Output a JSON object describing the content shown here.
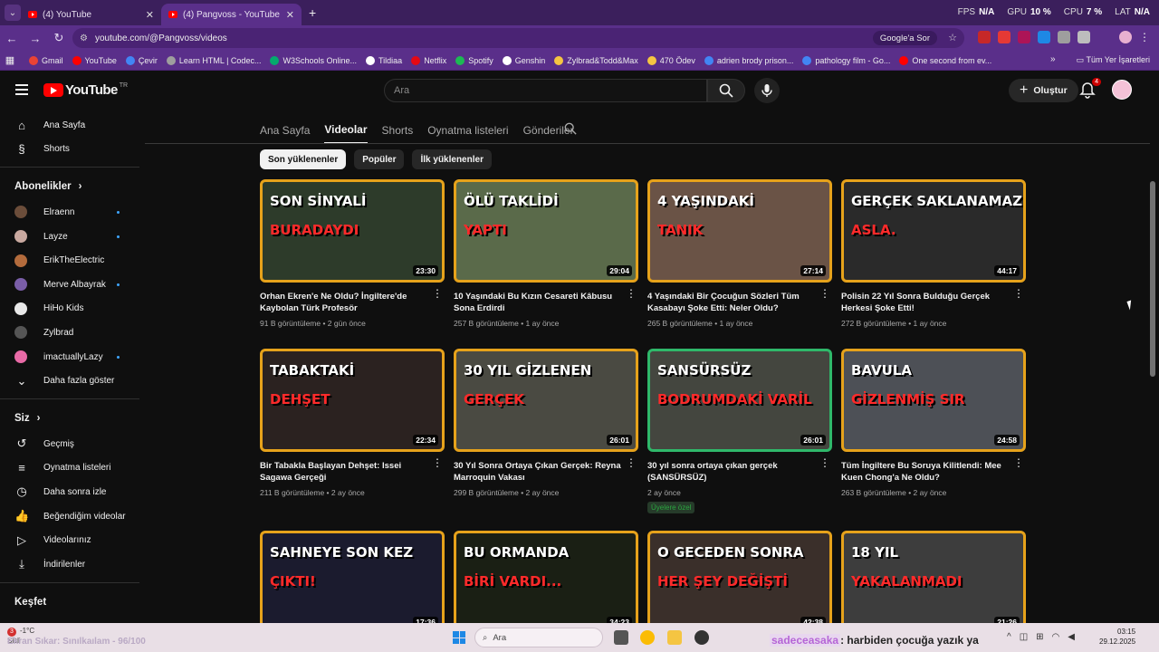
{
  "browser": {
    "tabs": [
      {
        "title": "(4) YouTube",
        "active": false
      },
      {
        "title": "(4) Pangvoss - YouTube",
        "active": true
      }
    ],
    "stats": [
      {
        "label": "FPS",
        "value": "N/A"
      },
      {
        "label": "GPU",
        "value": "10 %"
      },
      {
        "label": "CPU",
        "value": "7 %"
      },
      {
        "label": "LAT",
        "value": "N/A"
      }
    ],
    "url": "youtube.com/@Pangvoss/videos",
    "google_sor": "Google'a Sor",
    "bookmarks": [
      {
        "label": "Gmail",
        "color": "#ea4335"
      },
      {
        "label": "YouTube",
        "color": "#ff0000"
      },
      {
        "label": "Çevir",
        "color": "#4285f4"
      },
      {
        "label": "Learn HTML | Codec...",
        "color": "#9e9e9e"
      },
      {
        "label": "W3Schools Online...",
        "color": "#04aa6d"
      },
      {
        "label": "Tildiaa",
        "color": "#ffffff"
      },
      {
        "label": "Netflix",
        "color": "#e50914"
      },
      {
        "label": "Spotify",
        "color": "#1db954"
      },
      {
        "label": "Genshin",
        "color": "#ffffff"
      },
      {
        "label": "Zylbrad&Todd&Max",
        "color": "#f5c542"
      },
      {
        "label": "470 Ödev",
        "color": "#f5c542"
      },
      {
        "label": "adrien brody prison...",
        "color": "#4285f4"
      },
      {
        "label": "pathology film - Go...",
        "color": "#4285f4"
      },
      {
        "label": "One second from ev...",
        "color": "#ff0000"
      }
    ],
    "bookmarks_more": "»",
    "all_bookmarks": "Tüm Yer İşaretleri"
  },
  "header": {
    "logo": "YouTube",
    "logo_sup": "TR",
    "search_placeholder": "Ara",
    "create_label": "Oluştur",
    "notif_count": "4"
  },
  "sidebar": {
    "primary": [
      {
        "label": "Ana Sayfa",
        "icon": "home-icon",
        "glyph": "⌂"
      },
      {
        "label": "Shorts",
        "icon": "shorts-icon",
        "glyph": "§"
      }
    ],
    "subs_title": "Abonelikler",
    "subscriptions": [
      {
        "label": "Elraenn",
        "color": "#6b4d3a",
        "dot": true
      },
      {
        "label": "Layze",
        "color": "#c9a9a0",
        "dot": true
      },
      {
        "label": "ErikTheElectric",
        "color": "#b36b3c",
        "dot": false
      },
      {
        "label": "Merve Albayrak",
        "color": "#7a5ea8",
        "dot": true
      },
      {
        "label": "HiHo Kids",
        "color": "#e8e8e8",
        "dot": false
      },
      {
        "label": "Zylbrad",
        "color": "#555555",
        "dot": false
      },
      {
        "label": "imactuallyLazy",
        "color": "#e86aa6",
        "dot": true
      }
    ],
    "show_more": "Daha fazla göster",
    "you_title": "Siz",
    "you_items": [
      {
        "label": "Geçmiş",
        "icon": "history-icon",
        "glyph": "↺"
      },
      {
        "label": "Oynatma listeleri",
        "icon": "playlists-icon",
        "glyph": "≡"
      },
      {
        "label": "Daha sonra izle",
        "icon": "watch-later-icon",
        "glyph": "◷"
      },
      {
        "label": "Beğendiğim videolar",
        "icon": "like-icon",
        "glyph": "👍"
      },
      {
        "label": "Videolarınız",
        "icon": "your-videos-icon",
        "glyph": "▷"
      },
      {
        "label": "İndirilenler",
        "icon": "downloads-icon",
        "glyph": "⤓"
      }
    ],
    "explore_title": "Keşfet"
  },
  "channel": {
    "tabs": [
      "Ana Sayfa",
      "Videolar",
      "Shorts",
      "Oynatma listeleri",
      "Gönderiler"
    ],
    "active_tab": "Videolar",
    "chips": [
      "Son yüklenenler",
      "Popüler",
      "İlk yüklenenler"
    ],
    "active_chip": "Son yüklenenler"
  },
  "videos": [
    {
      "title": "Orhan Ekren'e Ne Oldu? İngiltere'de Kaybolan Türk Profesör",
      "meta": "91 B görüntüleme • 2 gün önce",
      "duration": "23:30",
      "t1": "SON SİNYALİ",
      "t2": "BURADAYDI",
      "bg": "#2d3b2a",
      "border": "#e6a21b"
    },
    {
      "title": "10 Yaşındaki Bu Kızın Cesareti Kâbusu Sona Erdirdi",
      "meta": "257 B görüntüleme • 1 ay önce",
      "duration": "29:04",
      "t1": "ÖLÜ TAKLİDİ",
      "t2": "YAPTI",
      "bg": "#5a6a4a",
      "border": "#e6a21b"
    },
    {
      "title": "4 Yaşındaki Bir Çocuğun Sözleri Tüm Kasabayı Şoke Etti: Neler Oldu?",
      "meta": "265 B görüntüleme • 1 ay önce",
      "duration": "27:14",
      "t1": "4 YAŞINDAKİ",
      "t2": "TANIK",
      "bg": "#6a5346",
      "border": "#e6a21b"
    },
    {
      "title": "Polisin 22 Yıl Sonra Bulduğu Gerçek Herkesi Şoke Etti!",
      "meta": "272 B görüntüleme • 1 ay önce",
      "duration": "44:17",
      "t1": "GERÇEK SAKLANAMAZ..",
      "t2": "ASLA.",
      "bg": "#2a2a2a",
      "border": "#e6a21b"
    },
    {
      "title": "Bir Tabakla Başlayan Dehşet: Issei Sagawa Gerçeği",
      "meta": "211 B görüntüleme • 2 ay önce",
      "duration": "22:34",
      "t1": "TABAKTAKİ",
      "t2": "DEHŞET",
      "bg": "#2b2220",
      "border": "#e6a21b"
    },
    {
      "title": "30 Yıl Sonra Ortaya Çıkan Gerçek: Reyna Marroquin Vakası",
      "meta": "299 B görüntüleme • 2 ay önce",
      "duration": "26:01",
      "t1": "30 YIL GİZLENEN",
      "t2": "GERÇEK",
      "bg": "#4a4a42",
      "border": "#e6a21b"
    },
    {
      "title": "30 yıl sonra ortaya çıkan gerçek (SANSÜRSÜZ)",
      "meta": "2 ay önce",
      "duration": "26:01",
      "t1": "SANSÜRSÜZ",
      "t2": "BODRUMDAKİ VARİL",
      "bg": "#44463f",
      "border": "#2fb86a",
      "members": "Üyelere özel"
    },
    {
      "title": "Tüm İngiltere Bu Soruya Kilitlendi: Mee Kuen Chong'a Ne Oldu?",
      "meta": "263 B görüntüleme • 2 ay önce",
      "duration": "24:58",
      "t1": "BAVULA",
      "t2": "GİZLENMİŞ SIR",
      "bg": "#4d5056",
      "border": "#e6a21b"
    },
    {
      "title": "",
      "meta": "",
      "duration": "17:36",
      "t1": "SAHNEYE SON KEZ",
      "t2": "ÇIKTI!",
      "bg": "#1b1b2e",
      "border": "#e6a21b"
    },
    {
      "title": "",
      "meta": "",
      "duration": "34:23",
      "t1": "BU ORMANDA",
      "t2": "BİRİ VARDI...",
      "bg": "#1a1f14",
      "border": "#e6a21b"
    },
    {
      "title": "",
      "meta": "",
      "duration": "42:38",
      "t1": "O GECEDEN SONRA",
      "t2": "HER ŞEY DEĞİŞTİ",
      "bg": "#3a2f2a",
      "border": "#e6a21b"
    },
    {
      "title": "",
      "meta": "",
      "duration": "21:26",
      "t1": "18 YIL",
      "t2": "YAKALANMADI",
      "bg": "#3d3d3d",
      "border": "#e6a21b"
    }
  ],
  "taskbar": {
    "weather_count": "3",
    "weather_temp": "-1°C",
    "weather_desc": "Sisli",
    "ticker": "Ekran Sıkar: Sınılkaılam - 96/100",
    "search": "Ara",
    "chat_user": "sadeceasaka",
    "chat_text": ": harbiden çocuğa yazık ya",
    "time": "03:15",
    "date": "29.12.2025"
  }
}
